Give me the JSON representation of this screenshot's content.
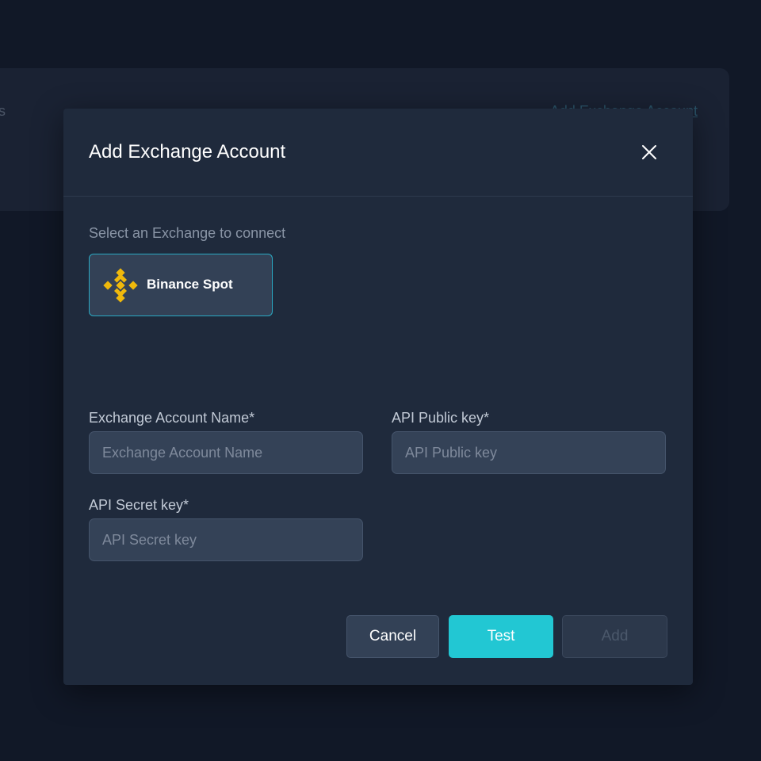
{
  "background": {
    "left_text": "s",
    "link_text": "Add Exchange Account"
  },
  "modal": {
    "title": "Add Exchange Account",
    "close_icon": "close-icon"
  },
  "exchange_select": {
    "label": "Select an Exchange to connect",
    "selected": {
      "name": "Binance Spot",
      "icon": "binance-logo-icon",
      "accent": "#F0B90B"
    }
  },
  "form": {
    "account_name": {
      "label": "Exchange Account Name*",
      "placeholder": "Exchange Account Name",
      "value": ""
    },
    "api_public_key": {
      "label": "API Public key*",
      "placeholder": "API Public key",
      "value": ""
    },
    "api_secret_key": {
      "label": "API Secret key*",
      "placeholder": "API Secret key",
      "value": ""
    }
  },
  "actions": {
    "cancel_label": "Cancel",
    "test_label": "Test",
    "add_label": "Add",
    "add_disabled": true
  },
  "colors": {
    "primary": "#22C7D3",
    "modal_bg": "#1F2A3C",
    "page_bg": "#111827",
    "selected_border": "#2AA9C3"
  }
}
